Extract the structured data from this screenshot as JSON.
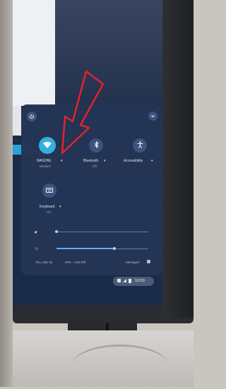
{
  "panel": {
    "wifi": {
      "label": "WASDNL",
      "status": "Medium"
    },
    "bluetooth": {
      "label": "Bluetooth",
      "status": "Off"
    },
    "accessibility": {
      "label": "Accessibility"
    },
    "keyboard": {
      "label": "Keyboard",
      "status": "US"
    },
    "volume": {
      "level": 0.0
    },
    "brightness": {
      "level": 0.9
    },
    "date": "Thu, Mar 15",
    "battery": "93% - 4:59 left",
    "managed": "Managed"
  },
  "shelf": {
    "time": "10:53"
  },
  "annotation": {
    "arrow_color": "#e0242a"
  },
  "colors": {
    "panel": "#243556",
    "wifi_on": "#36b3e6",
    "slider": "#5fb4ff"
  },
  "icons": [
    "power-icon",
    "chevron-down-icon",
    "wifi-icon",
    "bluetooth-icon",
    "accessibility-icon",
    "keyboard-icon",
    "volume-icon",
    "brightness-icon",
    "managed-icon",
    "red-arrow"
  ]
}
